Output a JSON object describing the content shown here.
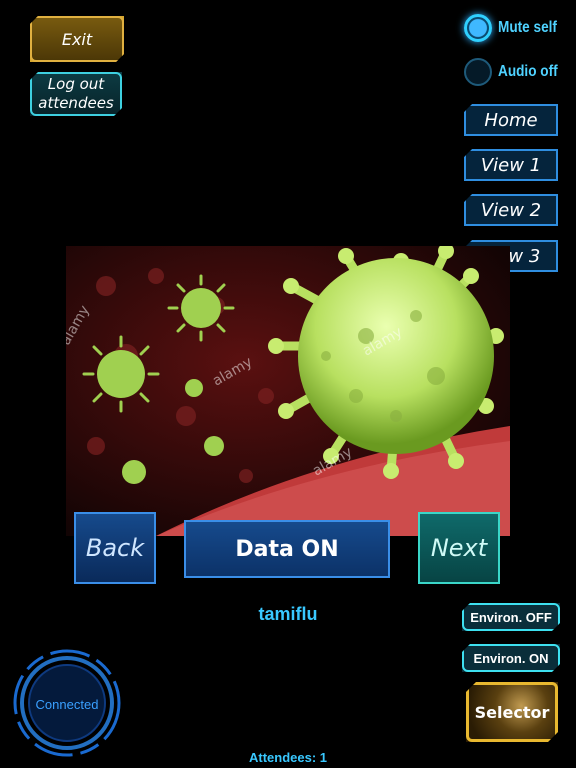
{
  "top_left": {
    "exit_label": "Exit",
    "logout_label_1": "Log out",
    "logout_label_2": "attendees"
  },
  "audio": {
    "mute_self_label": "Mute self",
    "mute_self_selected": true,
    "audio_off_label": "Audio off",
    "audio_off_selected": false
  },
  "views": [
    "Home",
    "View 1",
    "View 2",
    "view 3"
  ],
  "image": {
    "watermark": "alamy"
  },
  "bottom_nav": {
    "back": "Back",
    "data": "Data ON",
    "next": "Next"
  },
  "drug_name": "tamiflu",
  "environ": {
    "off": "Environ. OFF",
    "on": "Environ. ON"
  },
  "selector_label": "Selector",
  "status": {
    "connection": "Connected",
    "attendees": "Attendees: 1"
  },
  "colors": {
    "accent": "#39c8ff",
    "gold": "#e0b040",
    "virus": "#b8e060"
  }
}
